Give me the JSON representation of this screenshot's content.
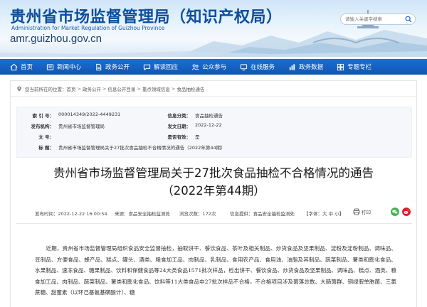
{
  "header": {
    "title": "贵州省市场监督管理局（知识产权局）",
    "subtitle": "Administration for Market Regulation of Guizhou Province",
    "domain": "amr.guizhou.gov.cn",
    "search_placeholder": "请输入关键字搜索"
  },
  "nav": {
    "items": [
      {
        "label": "首页",
        "icon": "home-icon"
      },
      {
        "label": "新闻中心",
        "icon": "news-icon"
      },
      {
        "label": "政务公开",
        "icon": "document-icon"
      },
      {
        "label": "解读回应",
        "icon": "chat-icon"
      },
      {
        "label": "公众参与",
        "icon": "people-icon"
      },
      {
        "label": "在线服务",
        "icon": "service-icon"
      },
      {
        "label": "政务数据",
        "icon": "data-icon"
      },
      {
        "label": "专题专栏",
        "icon": "topic-icon"
      }
    ]
  },
  "breadcrumb": {
    "prefix": "您当前所在的位置：",
    "items": [
      "首页",
      "政务公开",
      "信息公开目录",
      "重点领域信息",
      "食品抽检通告"
    ]
  },
  "meta": {
    "index_label": "索 引 号：",
    "index_value": "000014349/2022-4449231",
    "category_label": "信息分类：",
    "category_value": "食品抽检通告",
    "publisher_label": "发布机构：",
    "publisher_value": "贵州省市场监督管理局",
    "date_label": "发文日期：",
    "date_value": "2022-12-22",
    "docno_label": "文 号：",
    "docno_value": "",
    "valid_label": "是否有效：",
    "valid_value": "是",
    "name_label": "标 题：",
    "name_value": "贵州省市场监督管理局关于27批次食品抽检不合格情况的通告（2022年第44期）"
  },
  "article": {
    "title_line1": "贵州省市场监督管理局关于27批次食品抽检不合格情况的通告",
    "title_line2": "（2022年第44期）",
    "publish_time": "发布时间：2022-12-22 16:00:54",
    "source": "来源：食品安全抽检监测处",
    "views": "浏览次数：172次",
    "information": "信息提供：食品安全抽检监测处",
    "font_label": "【字体：",
    "font_large": "大",
    "font_medium": "中",
    "font_small": "小",
    "font_close": "】",
    "print_label": "打印",
    "body": "近期，贵州省市场监督管理局组织食品安全监督抽检，抽取饼干、餐饮食品、茶叶及相关制品、炒货食品及坚果制品、淀粉及淀粉制品、调味品、豆制品、方便食品、蜂产品、糕点、罐头、酒类、粮食加工品、肉制品、乳制品、食用农产品、食用油、油脂及其制品、蔬菜制品、薯类和膨化食品、水果制品、速冻食品、糖果制品、饮料和保健食品等24大类食品1571批次样品，检出饼干、餐饮食品、炒货食品及坚果制品、调味品、糕点、酒类、粮食加工品、肉制品、蔬菜制品、薯类和膨化食品、饮料等11大类食品中27批次样品不合格，不合格项目涉及菌落总数、大肠菌群、铜绿假单胞菌、三氯蔗糖、甜蜜素（以环己基氨基磺酸计）、糖"
  },
  "colors": {
    "nav_blue": "#1466c6",
    "title_blue": "#0d4d9c",
    "wechat_green": "#39b54a",
    "weibo_red": "#e6162d"
  }
}
